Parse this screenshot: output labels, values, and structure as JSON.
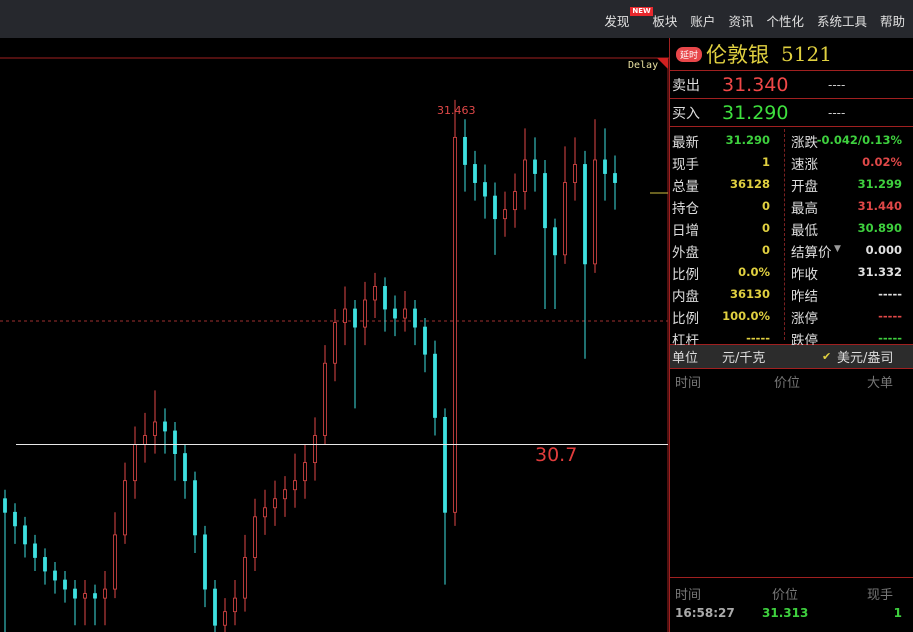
{
  "menu": {
    "items": [
      "发现",
      "板块",
      "账户",
      "资讯",
      "个性化",
      "系统工具",
      "帮助"
    ],
    "new_badge": "NEW"
  },
  "chart": {
    "delay_label": "Delay",
    "high_label": "31.463",
    "line_label": "30.7",
    "colors": {
      "up": "#e04848",
      "down": "#3ee0e0"
    },
    "chart_data": {
      "type": "candlestick",
      "ylim": [
        30.285,
        31.6
      ],
      "hline": 30.7,
      "high_marker": 31.463,
      "ohlc": [
        [
          30.58,
          30.6,
          30.2,
          30.55
        ],
        [
          30.55,
          30.57,
          30.48,
          30.52
        ],
        [
          30.52,
          30.54,
          30.45,
          30.48
        ],
        [
          30.48,
          30.5,
          30.42,
          30.45
        ],
        [
          30.45,
          30.47,
          30.39,
          30.42
        ],
        [
          30.42,
          30.44,
          30.37,
          30.4
        ],
        [
          30.4,
          30.42,
          30.35,
          30.38
        ],
        [
          30.38,
          30.4,
          30.3,
          30.36
        ],
        [
          30.36,
          30.4,
          30.3,
          30.37
        ],
        [
          30.37,
          30.39,
          30.3,
          30.36
        ],
        [
          30.36,
          30.42,
          30.3,
          30.38
        ],
        [
          30.38,
          30.55,
          30.36,
          30.5
        ],
        [
          30.5,
          30.66,
          30.48,
          30.62
        ],
        [
          30.62,
          30.74,
          30.58,
          30.7
        ],
        [
          30.7,
          30.77,
          30.66,
          30.72
        ],
        [
          30.72,
          30.82,
          30.68,
          30.75
        ],
        [
          30.75,
          30.78,
          30.68,
          30.73
        ],
        [
          30.73,
          30.75,
          30.62,
          30.68
        ],
        [
          30.68,
          30.7,
          30.58,
          30.62
        ],
        [
          30.62,
          30.64,
          30.46,
          30.5
        ],
        [
          30.5,
          30.52,
          30.34,
          30.38
        ],
        [
          30.38,
          30.4,
          30.28,
          30.3
        ],
        [
          30.3,
          30.36,
          30.28,
          30.33
        ],
        [
          30.33,
          30.4,
          30.3,
          30.36
        ],
        [
          30.36,
          30.5,
          30.33,
          30.45
        ],
        [
          30.45,
          30.58,
          30.42,
          30.54
        ],
        [
          30.54,
          30.6,
          30.5,
          30.56
        ],
        [
          30.56,
          30.62,
          30.52,
          30.58
        ],
        [
          30.58,
          30.63,
          30.54,
          30.6
        ],
        [
          30.6,
          30.68,
          30.56,
          30.62
        ],
        [
          30.62,
          30.7,
          30.58,
          30.66
        ],
        [
          30.66,
          30.76,
          30.62,
          30.72
        ],
        [
          30.72,
          30.92,
          30.7,
          30.88
        ],
        [
          30.88,
          31.0,
          30.84,
          30.97
        ],
        [
          30.97,
          31.05,
          30.92,
          31.0
        ],
        [
          31.0,
          31.02,
          30.78,
          30.96
        ],
        [
          30.96,
          31.06,
          30.92,
          31.02
        ],
        [
          31.02,
          31.08,
          30.98,
          31.05
        ],
        [
          31.05,
          31.07,
          30.95,
          31.0
        ],
        [
          31.0,
          31.03,
          30.94,
          30.98
        ],
        [
          30.98,
          31.04,
          30.95,
          31.0
        ],
        [
          31.0,
          31.02,
          30.92,
          30.96
        ],
        [
          30.96,
          30.98,
          30.86,
          30.9
        ],
        [
          30.9,
          30.93,
          30.72,
          30.76
        ],
        [
          30.76,
          30.78,
          30.39,
          30.55
        ],
        [
          30.55,
          31.463,
          30.52,
          31.38
        ],
        [
          31.38,
          31.42,
          31.26,
          31.32
        ],
        [
          31.32,
          31.35,
          31.24,
          31.28
        ],
        [
          31.28,
          31.32,
          31.2,
          31.25
        ],
        [
          31.25,
          31.28,
          31.12,
          31.2
        ],
        [
          31.2,
          31.26,
          31.16,
          31.22
        ],
        [
          31.22,
          31.3,
          31.18,
          31.26
        ],
        [
          31.26,
          31.4,
          31.22,
          31.33
        ],
        [
          31.33,
          31.38,
          31.26,
          31.3
        ],
        [
          31.3,
          31.33,
          31.0,
          31.18
        ],
        [
          31.18,
          31.2,
          31.0,
          31.12
        ],
        [
          31.12,
          31.36,
          31.1,
          31.28
        ],
        [
          31.28,
          31.38,
          31.24,
          31.32
        ],
        [
          31.32,
          31.35,
          30.89,
          31.1
        ],
        [
          31.1,
          31.42,
          31.08,
          31.33
        ],
        [
          31.33,
          31.4,
          31.24,
          31.3
        ],
        [
          31.3,
          31.34,
          31.22,
          31.28
        ]
      ]
    }
  },
  "panel": {
    "delay_tag": "延时",
    "name": "伦敦银",
    "code": "5121",
    "sell": {
      "label": "卖出",
      "price": "31.340",
      "vol": "----"
    },
    "buy": {
      "label": "买入",
      "price": "31.290",
      "vol": "----"
    },
    "stats_left": [
      {
        "label": "最新",
        "value": "31.290",
        "color": "#3ed03e"
      },
      {
        "label": "现手",
        "value": "1",
        "color": "#e0d040"
      },
      {
        "label": "总量",
        "value": "36128",
        "color": "#e0d040"
      },
      {
        "label": "持仓",
        "value": "0",
        "color": "#e0d040"
      },
      {
        "label": "日增",
        "value": "0",
        "color": "#e0d040"
      },
      {
        "label": "外盘",
        "value": "0",
        "color": "#e0d040"
      },
      {
        "label": "比例",
        "value": "0.0%",
        "color": "#e0d040"
      },
      {
        "label": "内盘",
        "value": "36130",
        "color": "#e0d040"
      },
      {
        "label": "比例",
        "value": "100.0%",
        "color": "#e0d040"
      },
      {
        "label": "杠杆",
        "value": "-----",
        "color": "#e0d040"
      }
    ],
    "stats_right": [
      {
        "label": "涨跌",
        "value": "-0.042/0.13%",
        "color": "#3ed03e"
      },
      {
        "label": "速涨",
        "value": "0.02%",
        "color": "#e04848"
      },
      {
        "label": "开盘",
        "value": "31.299",
        "color": "#3ed03e"
      },
      {
        "label": "最高",
        "value": "31.440",
        "color": "#e04848"
      },
      {
        "label": "最低",
        "value": "30.890",
        "color": "#3ed03e"
      },
      {
        "label": "结算价",
        "value": "0.000",
        "color": "#e0e0e0"
      },
      {
        "label": "昨收",
        "value": "31.332",
        "color": "#e0e0e0"
      },
      {
        "label": "昨结",
        "value": "-----",
        "color": "#e0e0e0"
      },
      {
        "label": "涨停",
        "value": "-----",
        "color": "#e04848"
      },
      {
        "label": "跌停",
        "value": "-----",
        "color": "#3ed03e"
      }
    ],
    "unit": {
      "label": "单位",
      "option1": "元/千克",
      "option2": "美元/盎司"
    },
    "big_orders": {
      "headers": [
        "时间",
        "价位",
        "大单"
      ]
    },
    "ticks": {
      "headers": [
        "时间",
        "价位",
        "现手"
      ],
      "rows": [
        {
          "time": "16:58:27",
          "price": "31.313",
          "vol": "1"
        }
      ]
    }
  }
}
